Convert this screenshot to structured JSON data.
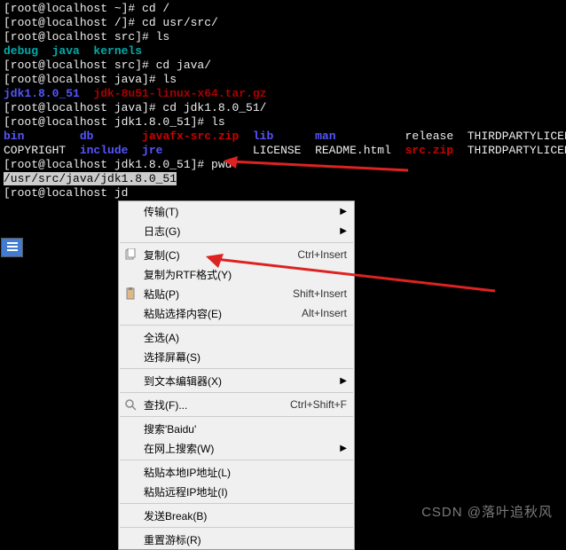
{
  "terminal": {
    "lines": [
      {
        "segs": [
          {
            "c": "white",
            "t": "[root@localhost ~]# cd /"
          }
        ]
      },
      {
        "segs": [
          {
            "c": "white",
            "t": "[root@localhost /]# cd usr/src/"
          }
        ]
      },
      {
        "segs": [
          {
            "c": "white",
            "t": "[root@localhost src]# ls"
          }
        ]
      },
      {
        "segs": [
          {
            "c": "cyan",
            "t": "debug  java  kernels"
          }
        ]
      },
      {
        "segs": [
          {
            "c": "white",
            "t": "[root@localhost src]# cd java/"
          }
        ]
      },
      {
        "segs": [
          {
            "c": "white",
            "t": "[root@localhost java]# ls"
          }
        ]
      },
      {
        "segs": [
          {
            "c": "blue",
            "t": "jdk1.8.0_51"
          },
          {
            "c": "white",
            "t": "  "
          },
          {
            "c": "darkred",
            "t": "jdk-8u51-linux-x64.tar.gz"
          }
        ]
      },
      {
        "segs": [
          {
            "c": "white",
            "t": "[root@localhost java]# cd jdk1.8.0_51/"
          }
        ]
      },
      {
        "segs": [
          {
            "c": "white",
            "t": "[root@localhost jdk1.8.0_51]# ls"
          }
        ]
      },
      {
        "segs": [
          {
            "c": "blue",
            "t": "bin"
          },
          {
            "c": "white",
            "t": "        "
          },
          {
            "c": "blue",
            "t": "db"
          },
          {
            "c": "white",
            "t": "       "
          },
          {
            "c": "red",
            "t": "javafx-src.zip"
          },
          {
            "c": "white",
            "t": "  "
          },
          {
            "c": "blue",
            "t": "lib"
          },
          {
            "c": "white",
            "t": "      "
          },
          {
            "c": "blue",
            "t": "man"
          },
          {
            "c": "white",
            "t": "          release  THIRDPARTYLICENSEREADME"
          }
        ]
      },
      {
        "segs": [
          {
            "c": "white",
            "t": "COPYRIGHT  "
          },
          {
            "c": "blue",
            "t": "include"
          },
          {
            "c": "white",
            "t": "  "
          },
          {
            "c": "blue",
            "t": "jre"
          },
          {
            "c": "white",
            "t": "             LICENSE  README.html  "
          },
          {
            "c": "red",
            "t": "src.zip"
          },
          {
            "c": "white",
            "t": "  THIRDPARTYLICENSEREADME"
          }
        ]
      },
      {
        "segs": [
          {
            "c": "white",
            "t": "[root@localhost jdk1.8.0_51]# pwd"
          }
        ]
      },
      {
        "segs": [
          {
            "c": "hlwhite",
            "t": "/usr/src/java/jdk1.8.0_51"
          }
        ]
      },
      {
        "segs": [
          {
            "c": "white",
            "t": "[root@localhost jd"
          }
        ]
      }
    ]
  },
  "menu": {
    "items": [
      {
        "type": "item",
        "label": "传输(T)",
        "sc": "",
        "sub": true,
        "icon": ""
      },
      {
        "type": "item",
        "label": "日志(G)",
        "sc": "",
        "sub": true,
        "icon": ""
      },
      {
        "type": "sep"
      },
      {
        "type": "item",
        "label": "复制(C)",
        "sc": "Ctrl+Insert",
        "sub": false,
        "icon": "copy"
      },
      {
        "type": "item",
        "label": "复制为RTF格式(Y)",
        "sc": "",
        "sub": false,
        "icon": ""
      },
      {
        "type": "item",
        "label": "粘贴(P)",
        "sc": "Shift+Insert",
        "sub": false,
        "icon": "paste"
      },
      {
        "type": "item",
        "label": "粘贴选择内容(E)",
        "sc": "Alt+Insert",
        "sub": false,
        "icon": ""
      },
      {
        "type": "sep"
      },
      {
        "type": "item",
        "label": "全选(A)",
        "sc": "",
        "sub": false,
        "icon": ""
      },
      {
        "type": "item",
        "label": "选择屏幕(S)",
        "sc": "",
        "sub": false,
        "icon": ""
      },
      {
        "type": "sep"
      },
      {
        "type": "item",
        "label": "到文本编辑器(X)",
        "sc": "",
        "sub": true,
        "icon": ""
      },
      {
        "type": "sep"
      },
      {
        "type": "item",
        "label": "查找(F)...",
        "sc": "Ctrl+Shift+F",
        "sub": false,
        "icon": "find"
      },
      {
        "type": "sep"
      },
      {
        "type": "item",
        "label": "搜索'Baidu'",
        "sc": "",
        "sub": false,
        "icon": ""
      },
      {
        "type": "item",
        "label": "在网上搜索(W)",
        "sc": "",
        "sub": true,
        "icon": ""
      },
      {
        "type": "sep"
      },
      {
        "type": "item",
        "label": "粘贴本地IP地址(L)",
        "sc": "",
        "sub": false,
        "icon": ""
      },
      {
        "type": "item",
        "label": "粘贴远程IP地址(I)",
        "sc": "",
        "sub": false,
        "icon": ""
      },
      {
        "type": "sep"
      },
      {
        "type": "item",
        "label": "发送Break(B)",
        "sc": "",
        "sub": false,
        "icon": ""
      },
      {
        "type": "sep"
      },
      {
        "type": "item",
        "label": "重置游标(R)",
        "sc": "",
        "sub": false,
        "icon": ""
      }
    ]
  },
  "watermark": "CSDN @落叶追秋风"
}
